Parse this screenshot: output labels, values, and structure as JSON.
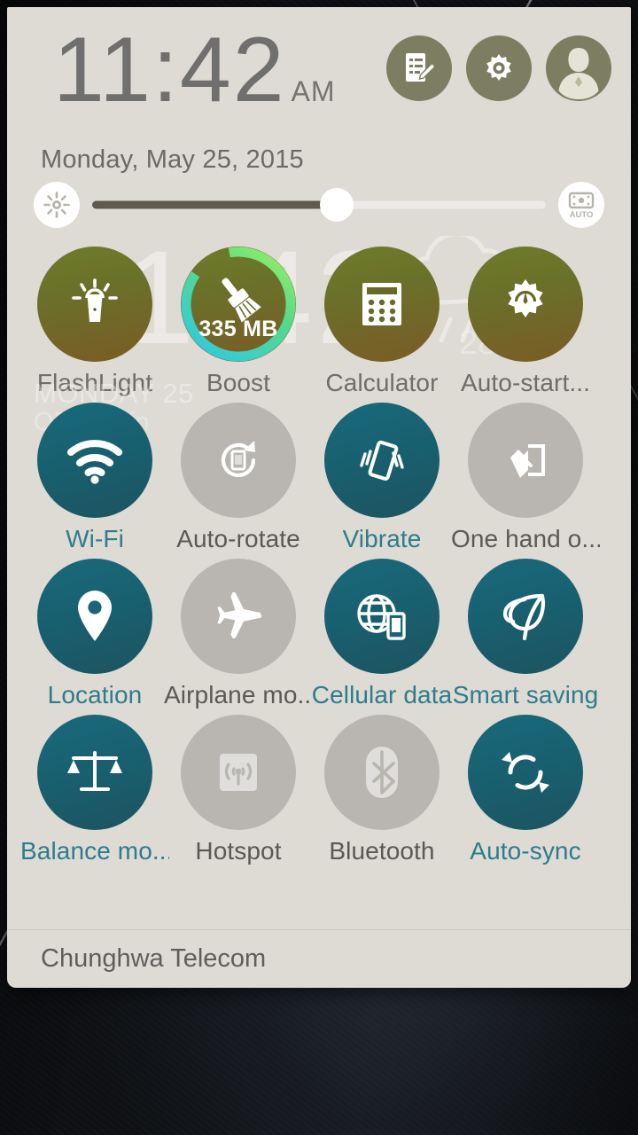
{
  "status": {
    "clock_time": "11:42",
    "clock_ampm": "AM",
    "date": "Monday, May 25, 2015"
  },
  "header": {
    "buttons": [
      {
        "name": "notes-editor-button",
        "icon": "notes-edit-icon"
      },
      {
        "name": "settings-button",
        "icon": "gear-icon"
      },
      {
        "name": "user-avatar-button",
        "icon": "avatar-icon"
      }
    ],
    "accent_olive": "#7d7d61"
  },
  "brightness": {
    "left_icon": "brightness-icon",
    "auto_label": "AUTO",
    "auto_icon": "auto-brightness-icon",
    "value_percent": 54
  },
  "ghost_widgets": {
    "time": "11:42",
    "line1": "MONDAY 25",
    "line2": "OFF, Rain",
    "temperature": "28°",
    "weather_icon": "rain-cloud-icon"
  },
  "tiles": [
    [
      {
        "label": "FlashLight",
        "icon": "flashlight-icon",
        "state": "olive"
      },
      {
        "label": "Boost",
        "icon": "broom-icon",
        "state": "olive",
        "badge": "335 MB",
        "ring_percent": 72
      },
      {
        "label": "Calculator",
        "icon": "calculator-icon",
        "state": "olive"
      },
      {
        "label": "Auto-start...",
        "icon": "autostart-gear-icon",
        "state": "olive"
      }
    ],
    [
      {
        "label": "Wi-Fi",
        "icon": "wifi-icon",
        "state": "on"
      },
      {
        "label": "Auto-rotate",
        "icon": "auto-rotate-icon",
        "state": "off"
      },
      {
        "label": "Vibrate",
        "icon": "vibrate-icon",
        "state": "on"
      },
      {
        "label": "One hand o...",
        "icon": "one-hand-mode-icon",
        "state": "off"
      }
    ],
    [
      {
        "label": "Location",
        "icon": "location-pin-icon",
        "state": "on"
      },
      {
        "label": "Airplane mo...",
        "icon": "airplane-icon",
        "state": "off"
      },
      {
        "label": "Cellular data",
        "icon": "cellular-data-icon",
        "state": "on"
      },
      {
        "label": "Smart saving",
        "icon": "leaf-icon",
        "state": "on"
      }
    ],
    [
      {
        "label": "Balance mo...",
        "icon": "scales-icon",
        "state": "on"
      },
      {
        "label": "Hotspot",
        "icon": "hotspot-icon",
        "state": "off"
      },
      {
        "label": "Bluetooth",
        "icon": "bluetooth-icon",
        "state": "off"
      },
      {
        "label": "Auto-sync",
        "icon": "sync-icon",
        "state": "on"
      }
    ]
  ],
  "footer": {
    "carrier": "Chunghwa Telecom"
  },
  "colors": {
    "panel_bg": "#dedad4",
    "tile_on": "#176a7c",
    "tile_off": "#b9b6b1",
    "tile_olive": "#6e7c2a",
    "label_on": "#2d7d8c",
    "label_off": "#5a5956"
  }
}
